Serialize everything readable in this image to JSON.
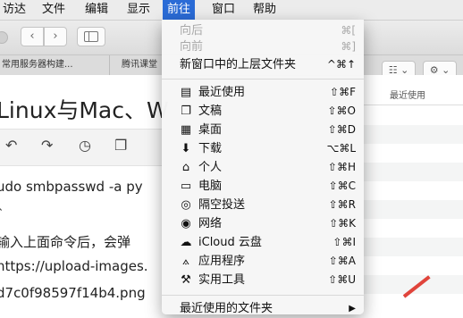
{
  "menubar": {
    "items": [
      {
        "label": "访达"
      },
      {
        "label": "文件"
      },
      {
        "label": "编辑"
      },
      {
        "label": "显示"
      },
      {
        "label": "前往"
      },
      {
        "label": "窗口"
      },
      {
        "label": "帮助"
      }
    ],
    "active_index": 4
  },
  "window": {
    "tabs": [
      "常用服务器构建...",
      "腾讯课堂"
    ],
    "column_header": "最近使用"
  },
  "blog": {
    "title": "Linux与Mac、W",
    "lines": [
      "udo smbpasswd -a py",
      "、",
      "输入上面命令后，会弹",
      "https://upload-images.",
      "d7c0f98597f14b4.png"
    ]
  },
  "go_menu": {
    "top_items": [
      {
        "label": "向后",
        "shortcut": "⌘[",
        "disabled": true
      },
      {
        "label": "向前",
        "shortcut": "⌘]",
        "disabled": true
      },
      {
        "label": "新窗口中的上层文件夹",
        "shortcut": "^⌘↑",
        "disabled": false
      }
    ],
    "places": [
      {
        "label": "最近使用",
        "shortcut": "⇧⌘F",
        "icon": "recents-icon"
      },
      {
        "label": "文稿",
        "shortcut": "⇧⌘O",
        "icon": "documents-icon"
      },
      {
        "label": "桌面",
        "shortcut": "⇧⌘D",
        "icon": "desktop-icon"
      },
      {
        "label": "下载",
        "shortcut": "⌥⌘L",
        "icon": "downloads-icon"
      },
      {
        "label": "个人",
        "shortcut": "⇧⌘H",
        "icon": "home-icon"
      },
      {
        "label": "电脑",
        "shortcut": "⇧⌘C",
        "icon": "computer-icon"
      },
      {
        "label": "隔空投送",
        "shortcut": "⇧⌘R",
        "icon": "airdrop-icon"
      },
      {
        "label": "网络",
        "shortcut": "⇧⌘K",
        "icon": "network-icon"
      },
      {
        "label": "iCloud 云盘",
        "shortcut": "⇧⌘I",
        "icon": "icloud-icon"
      },
      {
        "label": "应用程序",
        "shortcut": "⇧⌘A",
        "icon": "applications-icon"
      },
      {
        "label": "实用工具",
        "shortcut": "⇧⌘U",
        "icon": "utilities-icon"
      }
    ],
    "bottom_items": [
      {
        "label": "最近使用的文件夹",
        "shortcut": "▶"
      }
    ]
  },
  "colors": {
    "menu_highlight": "#2a6bd6",
    "annotation_red": "#e0443b"
  }
}
